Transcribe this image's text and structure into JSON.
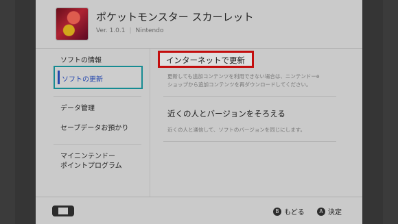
{
  "app": {
    "title": "ポケットモンスター スカーレット",
    "version": "Ver. 1.0.1",
    "publisher": "Nintendo",
    "icon": "game-cover-icon"
  },
  "sidebar": {
    "items": [
      {
        "label": "ソフトの情報"
      },
      {
        "label": "ソフトの更新",
        "selected": true
      },
      {
        "label": "データ管理"
      },
      {
        "label": "セーブデータお預かり"
      },
      {
        "label": "マイニンテンドー"
      },
      {
        "label": "ポイントプログラム"
      }
    ]
  },
  "main": {
    "options": [
      {
        "title": "インターネットで更新",
        "desc_line1": "更新しても追加コンテンツを利用できない場合は、ニンテンドーe",
        "desc_line2": "ショップから追加コンテンツを再ダウンロードしてください。"
      },
      {
        "title": "近くの人とバージョンをそろえる",
        "desc_line1": "近くの人と通信して、ソフトのバージョンを同じにします。"
      }
    ]
  },
  "footer": {
    "console_icon": "switch-console-icon",
    "back": {
      "button": "B",
      "label": "もどる"
    },
    "confirm": {
      "button": "A",
      "label": "決定"
    }
  },
  "colors": {
    "selection_border": "#1aa0a8",
    "selected_text": "#2a52c8",
    "highlight_border": "#e01010"
  }
}
